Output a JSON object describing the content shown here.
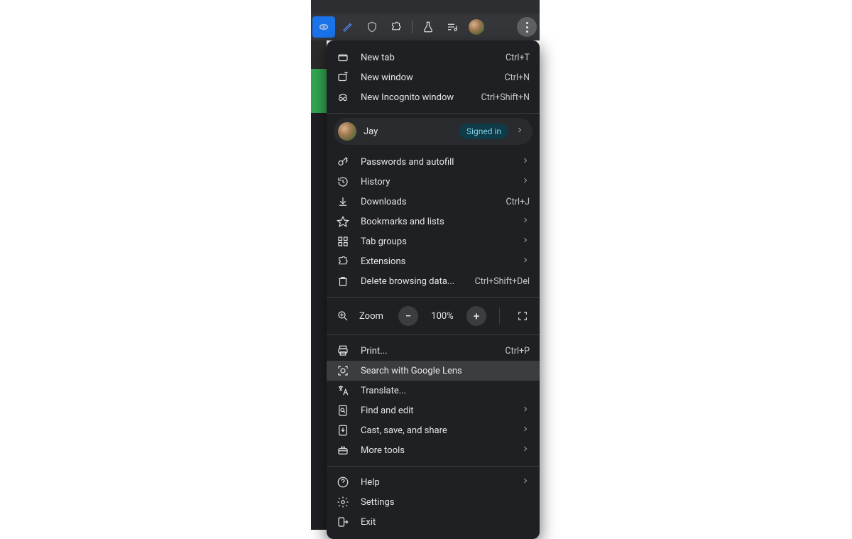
{
  "toolbar": {
    "icons": [
      "link",
      "marker",
      "shield",
      "puzzle",
      "flask",
      "playlist",
      "avatar"
    ]
  },
  "menu": {
    "new_tab": {
      "label": "New tab",
      "shortcut": "Ctrl+T"
    },
    "new_window": {
      "label": "New window",
      "shortcut": "Ctrl+N"
    },
    "incognito": {
      "label": "New Incognito window",
      "shortcut": "Ctrl+Shift+N"
    },
    "profile": {
      "name": "Jay",
      "status": "Signed in"
    },
    "passwords": {
      "label": "Passwords and autofill"
    },
    "history": {
      "label": "History"
    },
    "downloads": {
      "label": "Downloads",
      "shortcut": "Ctrl+J"
    },
    "bookmarks": {
      "label": "Bookmarks and lists"
    },
    "tabgroups": {
      "label": "Tab groups"
    },
    "extensions": {
      "label": "Extensions"
    },
    "delete_data": {
      "label": "Delete browsing data...",
      "shortcut": "Ctrl+Shift+Del"
    },
    "zoom": {
      "label": "Zoom",
      "value": "100%"
    },
    "print": {
      "label": "Print...",
      "shortcut": "Ctrl+P"
    },
    "lens": {
      "label": "Search with Google Lens"
    },
    "translate": {
      "label": "Translate..."
    },
    "find": {
      "label": "Find and edit"
    },
    "cast": {
      "label": "Cast, save, and share"
    },
    "more_tools": {
      "label": "More tools"
    },
    "help": {
      "label": "Help"
    },
    "settings": {
      "label": "Settings"
    },
    "exit": {
      "label": "Exit"
    }
  }
}
